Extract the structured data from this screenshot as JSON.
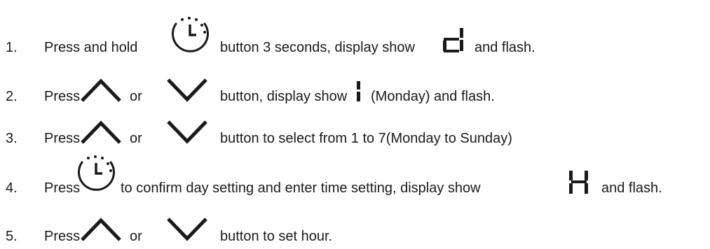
{
  "steps": [
    {
      "number": "1.",
      "parts": [
        "Press and hold",
        "button 3 seconds, display show",
        "and flash."
      ],
      "icons": [
        "clock-timer-icon",
        "segment-d-icon"
      ]
    },
    {
      "number": "2.",
      "parts": [
        "Press",
        "or",
        "button, display show",
        "(Monday) and flash."
      ],
      "icons": [
        "up-arrow-icon",
        "down-arrow-icon",
        "segment-1-icon"
      ]
    },
    {
      "number": "3.",
      "parts": [
        "Press",
        "or",
        "button to select from 1 to 7(Monday to Sunday)"
      ],
      "icons": [
        "up-arrow-icon",
        "down-arrow-icon"
      ]
    },
    {
      "number": "4.",
      "parts": [
        "Press",
        "to confirm day setting and enter time setting, display show",
        "and flash."
      ],
      "icons": [
        "clock-timer-icon",
        "segment-h-icon"
      ]
    },
    {
      "number": "5.",
      "parts": [
        "Press",
        "or",
        "button to set hour."
      ],
      "icons": [
        "up-arrow-icon",
        "down-arrow-icon"
      ]
    }
  ]
}
